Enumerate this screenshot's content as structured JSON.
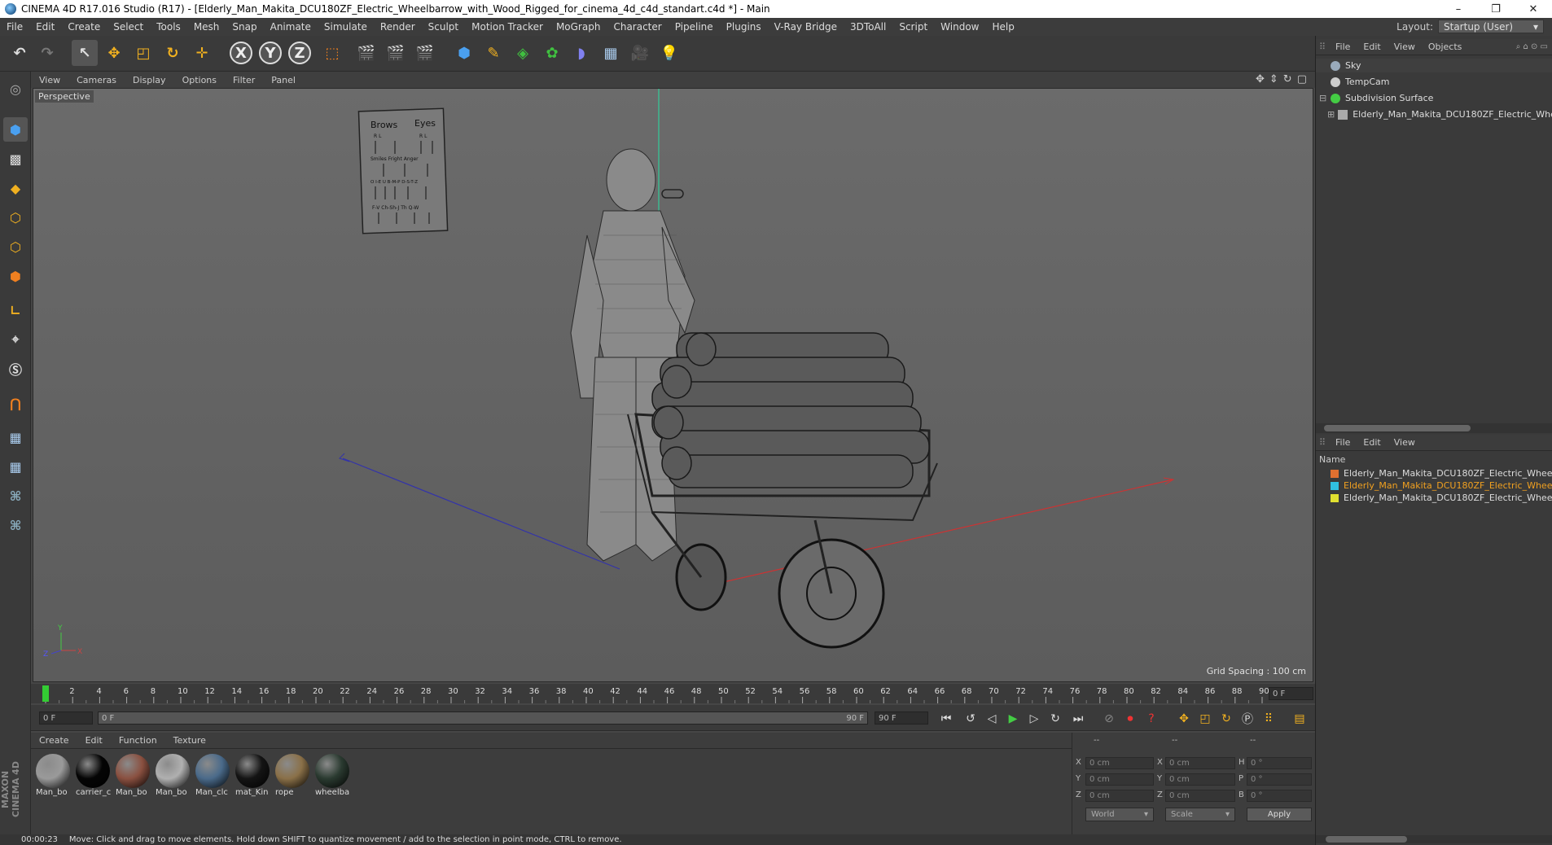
{
  "window": {
    "title": "CINEMA 4D R17.016 Studio (R17) - [Elderly_Man_Makita_DCU180ZF_Electric_Wheelbarrow_with_Wood_Rigged_for_cinema_4d_c4d_standart.c4d *] - Main",
    "minimize": "–",
    "restore": "❐",
    "close": "✕"
  },
  "menu": [
    "File",
    "Edit",
    "Create",
    "Select",
    "Tools",
    "Mesh",
    "Snap",
    "Animate",
    "Simulate",
    "Render",
    "Sculpt",
    "Motion Tracker",
    "MoGraph",
    "Character",
    "Pipeline",
    "Plugins",
    "V-Ray Bridge",
    "3DToAll",
    "Script",
    "Window",
    "Help"
  ],
  "layout": {
    "label": "Layout:",
    "value": "Startup (User)"
  },
  "toolbar": {
    "x_axis": "X",
    "y_axis": "Y",
    "z_axis": "Z"
  },
  "viewport": {
    "menu": [
      "View",
      "Cameras",
      "Display",
      "Options",
      "Filter",
      "Panel"
    ],
    "label": "Perspective",
    "grid_spacing": "Grid Spacing : 100 cm",
    "axis_y": "Y",
    "axis_z": "Z",
    "axis_x": "X",
    "face_chart": {
      "brows": "Brows",
      "eyes": "Eyes",
      "rl1": "R      L",
      "rl2": "R  L",
      "row1": "Smiles   Fright   Anger",
      "row2": "O  I-E  U   B-M-P  D-S-T-Z",
      "row3": "F-V   Ch-Sh-J   Th   Q-W"
    }
  },
  "timeline": {
    "ticks": [
      "0",
      "2",
      "4",
      "6",
      "8",
      "10",
      "12",
      "14",
      "16",
      "18",
      "20",
      "22",
      "24",
      "26",
      "28",
      "30",
      "32",
      "34",
      "36",
      "38",
      "40",
      "42",
      "44",
      "46",
      "48",
      "50",
      "52",
      "54",
      "56",
      "58",
      "60",
      "62",
      "64",
      "66",
      "68",
      "70",
      "72",
      "74",
      "76",
      "78",
      "80",
      "82",
      "84",
      "86",
      "88",
      "90"
    ],
    "current_frame": "0 F"
  },
  "transport": {
    "start": "0 F",
    "range_start": "0 F",
    "range_end": "90 F",
    "end": "90 F"
  },
  "materials": {
    "menu": [
      "Create",
      "Edit",
      "Function",
      "Texture"
    ],
    "items": [
      {
        "label": "Man_bo",
        "color": "#9a9a9a"
      },
      {
        "label": "carrier_c",
        "color": "#050505"
      },
      {
        "label": "Man_bo",
        "color": "#8a5040"
      },
      {
        "label": "Man_bo",
        "color": "#b0b0b0"
      },
      {
        "label": "Man_clc",
        "color": "#4a6a8a"
      },
      {
        "label": "mat_Kin",
        "color": "#141414"
      },
      {
        "label": "rope",
        "color": "#8a7048"
      },
      {
        "label": "wheelba",
        "color": "#2a3a30"
      }
    ]
  },
  "coords": {
    "head1": "--",
    "head2": "--",
    "head3": "--",
    "rows": [
      {
        "a": "X",
        "av": "0 cm",
        "b": "X",
        "bv": "0 cm",
        "c": "H",
        "cv": "0 °"
      },
      {
        "a": "Y",
        "av": "0 cm",
        "b": "Y",
        "bv": "0 cm",
        "c": "P",
        "cv": "0 °"
      },
      {
        "a": "Z",
        "av": "0 cm",
        "b": "Z",
        "bv": "0 cm",
        "c": "B",
        "cv": "0 °"
      }
    ],
    "world": "World",
    "scale": "Scale",
    "apply": "Apply"
  },
  "status": {
    "time": "00:00:23",
    "message": "Move: Click and drag to move elements. Hold down SHIFT to quantize movement / add to the selection in point mode, CTRL to remove."
  },
  "objects": {
    "menu": [
      "File",
      "Edit",
      "View",
      "Objects"
    ],
    "items": [
      {
        "name": "Sky",
        "color": "#9ab"
      },
      {
        "name": "TempCam",
        "color": "#ccc"
      },
      {
        "name": "Subdivision Surface",
        "color": "#4c4"
      },
      {
        "name": "Elderly_Man_Makita_DCU180ZF_Electric_Whe",
        "color": "#aaa"
      }
    ]
  },
  "layers": {
    "menu": [
      "File",
      "Edit",
      "View"
    ],
    "header": "Name",
    "items": [
      {
        "name": "Elderly_Man_Makita_DCU180ZF_Electric_Whee",
        "color": "#e07030",
        "text": "#dddddd"
      },
      {
        "name": "Elderly_Man_Makita_DCU180ZF_Electric_Whee",
        "color": "#30c0e0",
        "text": "#f0a020"
      },
      {
        "name": "Elderly_Man_Makita_DCU180ZF_Electric_Whee",
        "color": "#e0e030",
        "text": "#dddddd"
      }
    ]
  }
}
